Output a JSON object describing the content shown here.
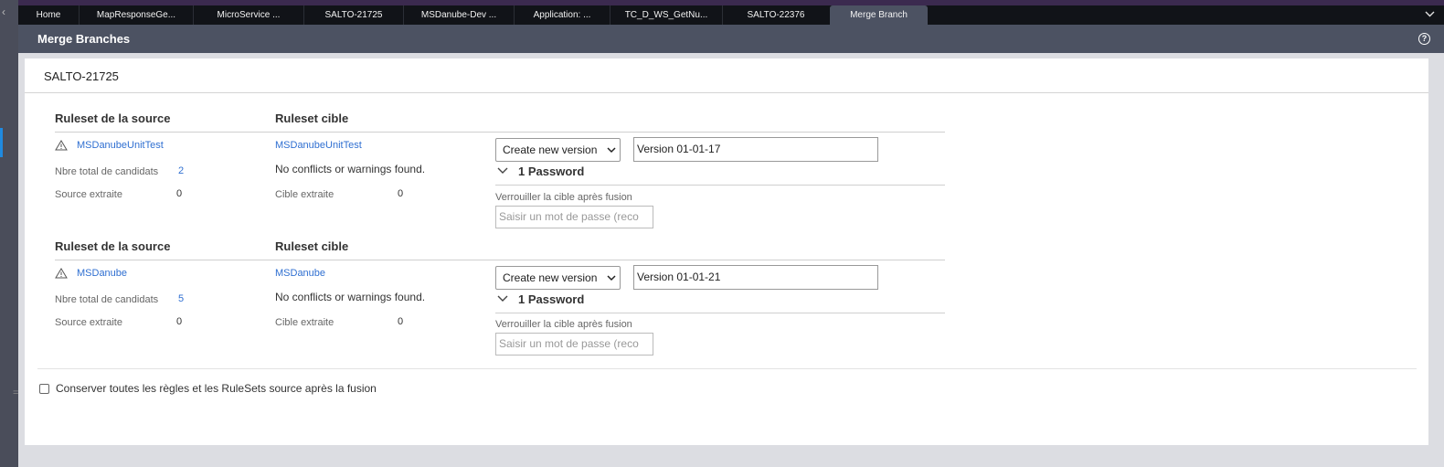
{
  "tabs": [
    {
      "label": "Home"
    },
    {
      "label": "MapResponseGe..."
    },
    {
      "label": "MicroService ..."
    },
    {
      "label": "SALTO-21725"
    },
    {
      "label": "MSDanube-Dev ..."
    },
    {
      "label": "Application: ..."
    },
    {
      "label": "TC_D_WS_GetNu..."
    },
    {
      "label": "SALTO-22376"
    },
    {
      "label": "Merge Branch"
    }
  ],
  "header": {
    "title": "Merge Branches"
  },
  "panel": {
    "title": "SALTO-21725"
  },
  "rulesets": [
    {
      "source_heading": "Ruleset de la source",
      "target_heading": "Ruleset cible",
      "source_name": "MSDanubeUnitTest",
      "target_name": "MSDanubeUnitTest",
      "candidates_label": "Nbre total de candidats",
      "candidates_value": "2",
      "source_extracted_label": "Source extraite",
      "source_extracted_value": "0",
      "target_extracted_label": "Cible extraite",
      "target_extracted_value": "0",
      "message": "No conflicts or warnings found.",
      "version_action": "Create new version",
      "version_value": "Version 01-01-17",
      "password_toggle": "1 Password",
      "lock_label": "Verrouiller la cible après fusion",
      "password_placeholder": "Saisir un mot de passe (reco"
    },
    {
      "source_heading": "Ruleset de la source",
      "target_heading": "Ruleset cible",
      "source_name": "MSDanube",
      "target_name": "MSDanube",
      "candidates_label": "Nbre total de candidats",
      "candidates_value": "5",
      "source_extracted_label": "Source extraite",
      "source_extracted_value": "0",
      "target_extracted_label": "Cible extraite",
      "target_extracted_value": "0",
      "message": "No conflicts or warnings found.",
      "version_action": "Create new version",
      "version_value": "Version 01-01-21",
      "password_toggle": "1 Password",
      "lock_label": "Verrouiller la cible après fusion",
      "password_placeholder": "Saisir un mot de passe (reco"
    }
  ],
  "keep_rules_label": "Conserver toutes les règles et les RuleSets source après la fusion",
  "colors": {
    "link": "#2f6fd1",
    "header_bg": "#4c5262",
    "tabbar_bg": "#111318"
  }
}
